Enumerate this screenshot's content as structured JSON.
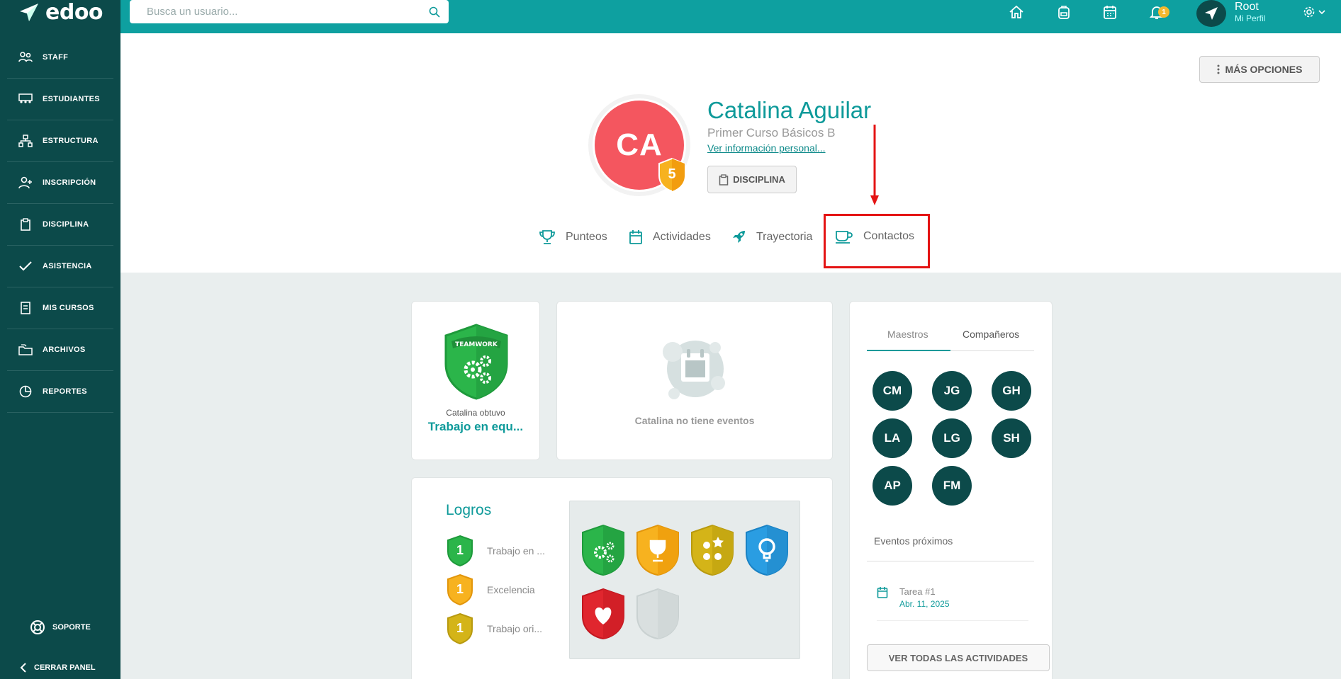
{
  "app": {
    "name": "edoo"
  },
  "sidebar": {
    "items": [
      {
        "label": "STAFF",
        "icon": "staff-icon"
      },
      {
        "label": "ESTUDIANTES",
        "icon": "students-icon"
      },
      {
        "label": "ESTRUCTURA",
        "icon": "structure-icon"
      },
      {
        "label": "INSCRIPCIÓN",
        "icon": "add-user-icon"
      },
      {
        "label": "DISCIPLINA",
        "icon": "clipboard-icon"
      },
      {
        "label": "ASISTENCIA",
        "icon": "check-icon"
      },
      {
        "label": "MIS CURSOS",
        "icon": "book-icon"
      },
      {
        "label": "ARCHIVOS",
        "icon": "folders-icon"
      },
      {
        "label": "REPORTES",
        "icon": "chart-icon"
      }
    ],
    "support_label": "SOPORTE",
    "collapse_label": "CERRAR PANEL"
  },
  "topbar": {
    "search_placeholder": "Busca un usuario...",
    "notification_count": "1",
    "profile_name": "Root",
    "profile_sub": "Mi Perfil"
  },
  "header": {
    "more_options": "MÁS OPCIONES",
    "initials": "CA",
    "level": "5",
    "name": "Catalina Aguilar",
    "course": "Primer Curso Básicos B",
    "personal_link": "Ver información personal...",
    "discipline_button": "DISCIPLINA",
    "tabs": [
      "Punteos",
      "Actividades",
      "Trayectoria",
      "Contactos"
    ]
  },
  "achievement_card": {
    "shield_text": "TEAMWORK",
    "caption": "Catalina obtuvo",
    "title": "Trabajo en equ..."
  },
  "events_card": {
    "empty_text": "Catalina no tiene eventos"
  },
  "logros": {
    "title": "Logros",
    "items": [
      {
        "count": "1",
        "label": "Trabajo en ...",
        "color": "#2bb54a"
      },
      {
        "count": "1",
        "label": "Excelencia",
        "color": "#f7b21f"
      },
      {
        "count": "1",
        "label": "Trabajo ori...",
        "color": "#d4b418"
      }
    ]
  },
  "contacts_panel": {
    "tabs": [
      "Maestros",
      "Compañeros"
    ],
    "contacts": [
      "CM",
      "JG",
      "GH",
      "LA",
      "LG",
      "SH",
      "AP",
      "FM"
    ],
    "upcoming_title": "Eventos próximos",
    "event": {
      "title": "Tarea #1",
      "date": "Abr. 11, 2025"
    },
    "all_button": "VER TODAS LAS ACTIVIDADES"
  },
  "colors": {
    "teal": "#0ea0a0",
    "dark": "#0c4a4a",
    "avatar": "#f4565f",
    "highlight": "#e41414"
  }
}
